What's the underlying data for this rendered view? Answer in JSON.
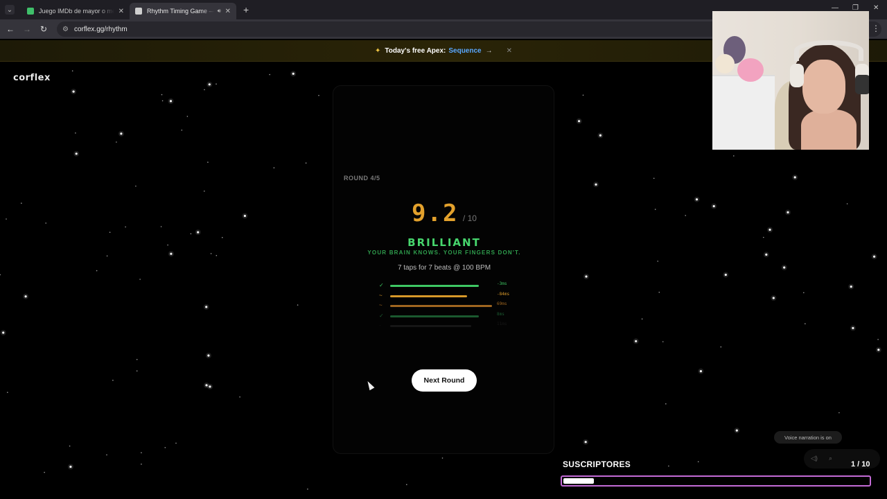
{
  "browser": {
    "tabs": [
      {
        "title": "Juego IMDb de mayor o menor",
        "favicon_color": "#3fbf6a",
        "active": false
      },
      {
        "title": "Rhythm Timing Game — Free",
        "favicon_color": "#cfcfcf",
        "active": true
      }
    ],
    "url": "corflex.gg/rhythm"
  },
  "banner": {
    "prefix": "Today's free Apex:",
    "link": "Sequence",
    "arrow": "→",
    "close": "✕"
  },
  "site": {
    "logo": "corflex"
  },
  "game": {
    "round_label": "ROUND 4/5",
    "score": "9.2",
    "score_denominator": "/ 10",
    "verdict": "BRILLIANT",
    "tagline": "YOUR BRAIN KNOWS. YOUR FINGERS DON'T.",
    "taps_summary": "7 taps for 7 beats @ 100 BPM",
    "next_button": "Next Round",
    "timing_rows": [
      {
        "mark": "✓",
        "offset": "-3ms",
        "color": "#3ec763",
        "fill": 0.85,
        "opacity": 1
      },
      {
        "mark": "~",
        "offset": "-84ms",
        "color": "#e3a12c",
        "fill": 0.74,
        "opacity": 0.95
      },
      {
        "mark": "~",
        "offset": "69ms",
        "color": "#d4882a",
        "fill": 0.98,
        "opacity": 0.75
      },
      {
        "mark": "✓",
        "offset": "8ms",
        "color": "#2fa054",
        "fill": 0.85,
        "opacity": 0.55
      },
      {
        "mark": "·",
        "offset": "11ms",
        "color": "#3a3a3a",
        "fill": 0.78,
        "opacity": 0.35
      }
    ]
  },
  "overlay": {
    "voice_narration": "Voice narration is on",
    "counter": "1 / 10",
    "subs_label": "SUSCRIPTORES",
    "subs_progress": 0.1
  },
  "colors": {
    "accent_score": "#e3a12c",
    "accent_verdict": "#47d66d",
    "subs_border": "#c36bd6"
  }
}
